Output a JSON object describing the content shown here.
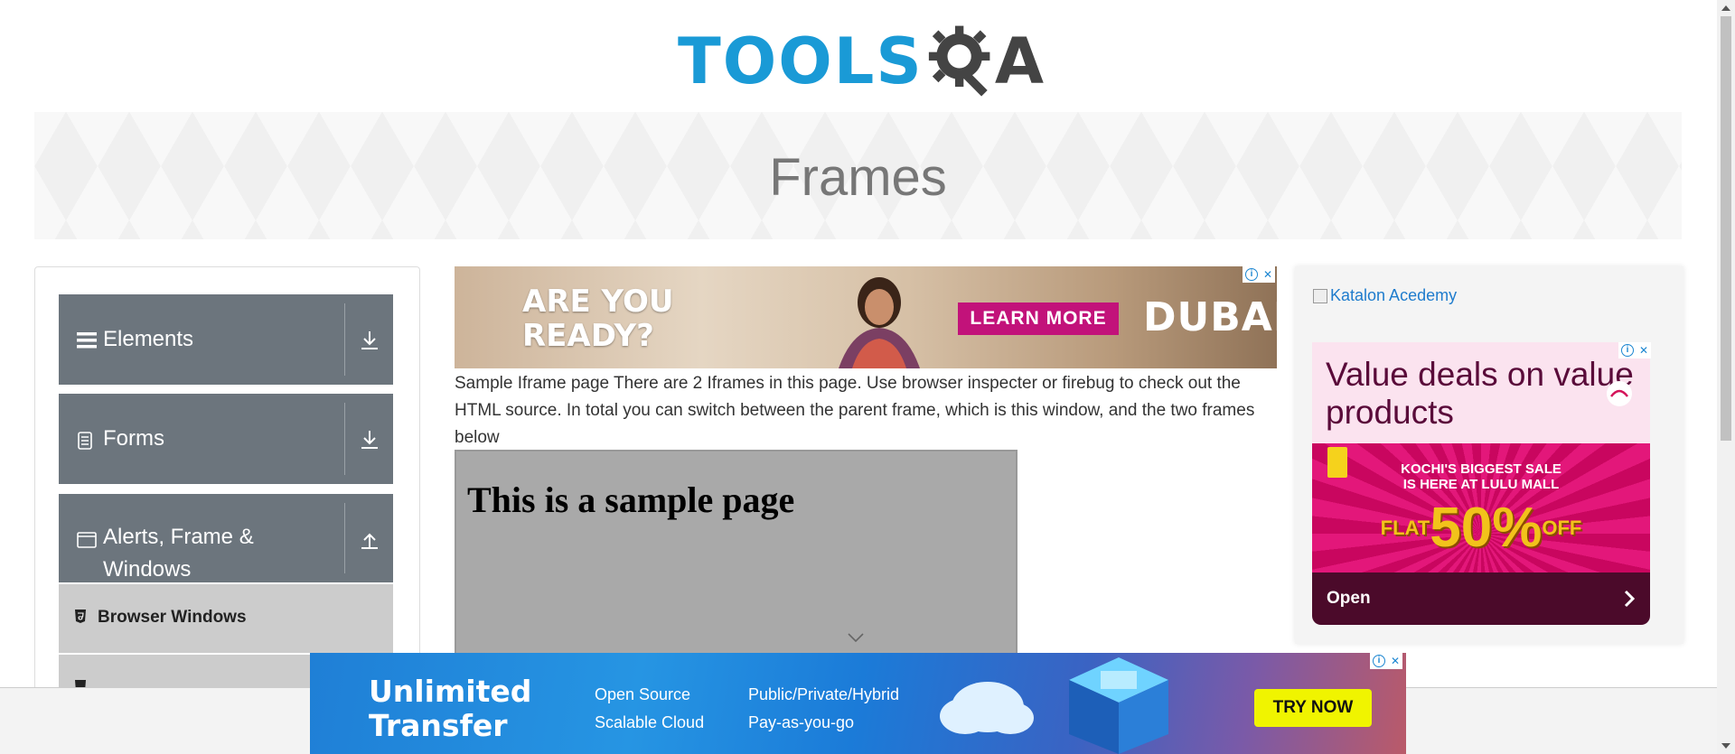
{
  "header": {
    "logo_text": "TOOLS",
    "logo_suffix": "A",
    "page_title": "Frames"
  },
  "sidebar": {
    "groups": [
      {
        "label": "Elements",
        "icon": "hamburger-icon",
        "toggle": "download-icon"
      },
      {
        "label": "Forms",
        "icon": "document-icon",
        "toggle": "download-icon"
      },
      {
        "label": "Alerts, Frame & Windows",
        "label_line1": "Alerts, Frame &",
        "label_line2": "Windows",
        "icon": "window-icon",
        "toggle": "upload-icon"
      }
    ],
    "items": [
      {
        "label": "Browser Windows",
        "icon": "html5-icon"
      },
      {
        "label": "",
        "icon": "html5-icon"
      }
    ]
  },
  "top_ad": {
    "headline_line1": "ARE YOU",
    "headline_line2": "READY?",
    "cta": "LEARN MORE",
    "brand": "DUBAI"
  },
  "main": {
    "description": "Sample Iframe page There are 2 Iframes in this page. Use browser inspecter or firebug to check out the HTML source. In total you can switch between the parent frame, which is this window, and the two frames below",
    "iframe_heading": "This is a sample page"
  },
  "right_ad": {
    "katalon_alt": "Katalon Acedemy",
    "headline": "Value deals on value products",
    "promo_line1": "KOCHI'S BIGGEST SALE",
    "promo_line2": "IS HERE AT LULU MALL",
    "flat_label": "FLAT",
    "discount": "50%",
    "off_label": "OFF",
    "open_label": "Open"
  },
  "bottom_ad": {
    "headline_line1": "Unlimited",
    "headline_line2": "Transfer",
    "feature1": "Open Source",
    "feature2": "Scalable Cloud",
    "feature3": "Public/Private/Hybrid",
    "feature4": "Pay-as-you-go",
    "cta": "TRY NOW"
  },
  "colors": {
    "brand_blue": "#1a9ad6",
    "nav_gray": "#6c757d",
    "link_blue": "#1f7ccd"
  }
}
